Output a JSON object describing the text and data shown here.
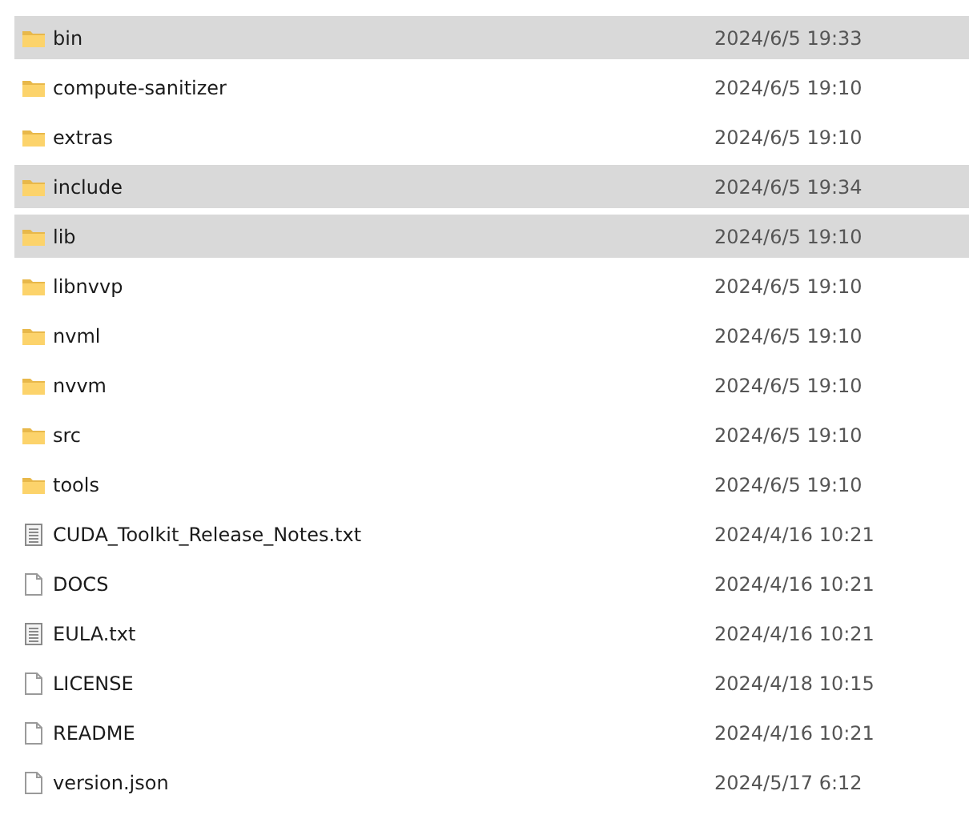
{
  "files": [
    {
      "name": "bin",
      "modified": "2024/6/5 19:33",
      "kind": "folder",
      "selected": true
    },
    {
      "name": "compute-sanitizer",
      "modified": "2024/6/5 19:10",
      "kind": "folder",
      "selected": false
    },
    {
      "name": "extras",
      "modified": "2024/6/5 19:10",
      "kind": "folder",
      "selected": false
    },
    {
      "name": "include",
      "modified": "2024/6/5 19:34",
      "kind": "folder",
      "selected": true
    },
    {
      "name": "lib",
      "modified": "2024/6/5 19:10",
      "kind": "folder",
      "selected": true
    },
    {
      "name": "libnvvp",
      "modified": "2024/6/5 19:10",
      "kind": "folder",
      "selected": false
    },
    {
      "name": "nvml",
      "modified": "2024/6/5 19:10",
      "kind": "folder",
      "selected": false
    },
    {
      "name": "nvvm",
      "modified": "2024/6/5 19:10",
      "kind": "folder",
      "selected": false
    },
    {
      "name": "src",
      "modified": "2024/6/5 19:10",
      "kind": "folder",
      "selected": false
    },
    {
      "name": "tools",
      "modified": "2024/6/5 19:10",
      "kind": "folder",
      "selected": false
    },
    {
      "name": "CUDA_Toolkit_Release_Notes.txt",
      "modified": "2024/4/16 10:21",
      "kind": "text",
      "selected": false
    },
    {
      "name": "DOCS",
      "modified": "2024/4/16 10:21",
      "kind": "file",
      "selected": false
    },
    {
      "name": "EULA.txt",
      "modified": "2024/4/16 10:21",
      "kind": "text",
      "selected": false
    },
    {
      "name": "LICENSE",
      "modified": "2024/4/18 10:15",
      "kind": "file",
      "selected": false
    },
    {
      "name": "README",
      "modified": "2024/4/16 10:21",
      "kind": "file",
      "selected": false
    },
    {
      "name": "version.json",
      "modified": "2024/5/17 6:12",
      "kind": "file",
      "selected": false
    }
  ]
}
